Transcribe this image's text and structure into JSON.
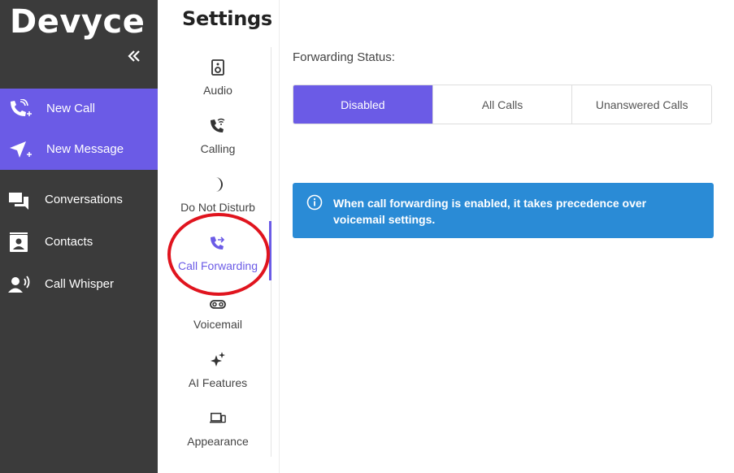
{
  "app": {
    "logo": "Devyce"
  },
  "sidebar": {
    "collapse_icon": "double-chevron-left-icon",
    "primary_items": [
      {
        "label": "New Call",
        "icon": "phone-plus-icon"
      },
      {
        "label": "New Message",
        "icon": "send-plus-icon"
      }
    ],
    "items": [
      {
        "label": "Conversations",
        "icon": "chat-icon"
      },
      {
        "label": "Contacts",
        "icon": "contact-card-icon"
      },
      {
        "label": "Call Whisper",
        "icon": "user-voice-icon"
      }
    ]
  },
  "settings": {
    "title": "Settings",
    "items": [
      {
        "label": "Audio",
        "icon": "speaker-icon"
      },
      {
        "label": "Calling",
        "icon": "phone-wifi-icon"
      },
      {
        "label": "Do Not Disturb",
        "icon": "moon-icon"
      },
      {
        "label": "Call Forwarding",
        "icon": "phone-forward-icon",
        "active": true
      },
      {
        "label": "Voicemail",
        "icon": "voicemail-icon"
      },
      {
        "label": "AI Features",
        "icon": "sparkles-icon"
      },
      {
        "label": "Appearance",
        "icon": "devices-icon"
      }
    ]
  },
  "main": {
    "status_label": "Forwarding Status:",
    "options": [
      "Disabled",
      "All Calls",
      "Unanswered Calls"
    ],
    "selected": "Disabled",
    "info_text": "When call forwarding is enabled, it takes precedence over voicemail settings."
  },
  "colors": {
    "accent": "#6b5be6",
    "sidebar_bg": "#3b3b3b",
    "info_bg": "#2a8bd6",
    "annotation": "#e0141e"
  }
}
